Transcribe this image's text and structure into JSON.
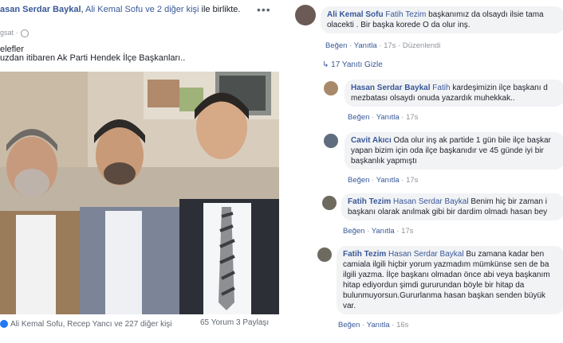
{
  "post": {
    "author": "asan Serdar Baykal",
    "with_text": "ile birlikte.",
    "tagged_link": "Ali Kemal Sofu ve 2 diğer kişi",
    "more_label": "•••",
    "meta_time": "gsat ·",
    "text_line1": "elefler",
    "text_line2": "uzdan itibaren Ak Parti Hendek İlçe Başkanları..",
    "reactions_text": "Ali Kemal Sofu, Recep Yancı ve 227 diğer kişi",
    "comments_count": "65 Yorum",
    "shares_count": "3 Paylaşı"
  },
  "comments": [
    {
      "name": "Ali Kemal Sofu",
      "mention": "Fatih Tezim",
      "line1": "başkanımız da olsaydı ilsie tama",
      "line2": "olacekti . Bir başka korede O da olur inş.",
      "like": "Beğen",
      "reply": "Yanıtla",
      "time": "17s",
      "extra": "Düzenlendi"
    },
    {
      "name": "Hasan Serdar Baykal",
      "mention": "Fatih",
      "line1": "kardeşimizin ilçe başkanı d",
      "line2": "mezbatası olsaydı onuda yazardık muhekkak..",
      "like": "Beğen",
      "reply": "Yanıtla",
      "time": "17s"
    },
    {
      "name": "Cavit Akıcı",
      "mention": "",
      "line1": "Oda olur inş ak partide 1 gün bile ilçe başkar",
      "line2": "yapan bizim için oda ilçe başkanıdır ve 45 günde iyi bir",
      "line3": "başkanlık yapmıştı",
      "like": "Beğen",
      "reply": "Yanıtla",
      "time": "17s"
    },
    {
      "name": "Fatih Tezim",
      "mention": "Hasan Serdar Baykal",
      "line1": "Benim hiç bir zaman i",
      "line2": "başkanı olarak anılmak gibi bir dardim olmadı hasan bey",
      "like": "Beğen",
      "reply": "Yanıtla",
      "time": "17s"
    },
    {
      "name": "Fatih Tezim",
      "mention": "Hasan Serdar Baykal",
      "line1": "Bu zamana kadar ben",
      "line2": "camiala ilgili hiçbir yorum yazmadım mümkünse sen de ba",
      "line3": "ilgili yazma. İlçe başkanı olmadan önce abi veya başkanım",
      "line4": "hitap ediyordun şimdi gururundan böyle bir hitap da",
      "line5": "bulunmuyorsun.Gururlanma hasan başkan senden büyük",
      "line6": "var.",
      "like": "Beğen",
      "reply": "Yanıtla",
      "time": "16s"
    }
  ],
  "reply_toggle": "17 Yanıtı Gizle",
  "colors": {
    "link": "#385898",
    "meta": "#90949c",
    "bubble": "#f2f3f5"
  }
}
